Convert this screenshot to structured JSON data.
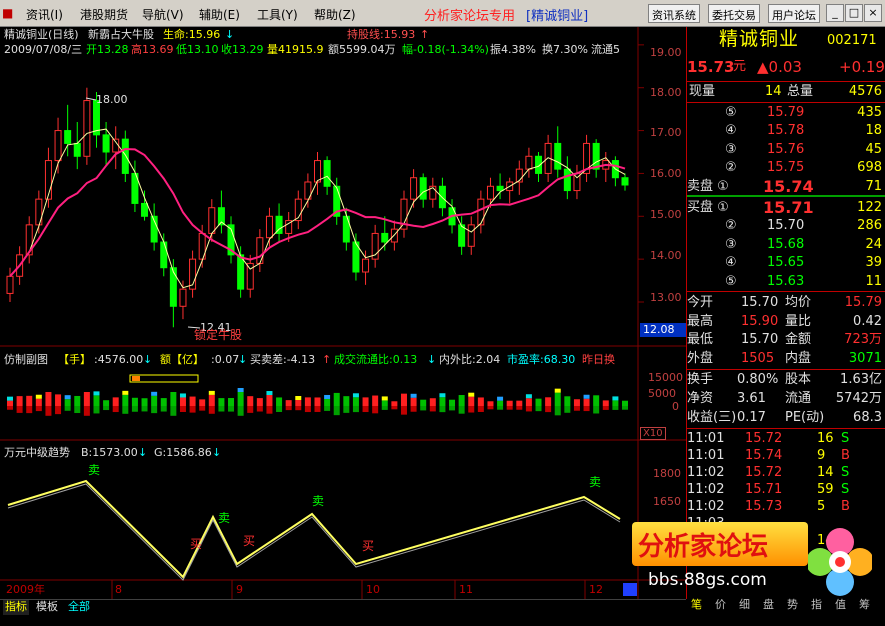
{
  "menu": {
    "items": [
      "资讯(I)",
      "港股期货",
      "导航(V)",
      "辅助(E)",
      "工具(Y)",
      "帮助(Z)"
    ],
    "title_red": "分析家论坛专用",
    "title_bracket": "[精诚铜业]",
    "right_buttons": [
      "资讯系统",
      "委托交易",
      "用户论坛"
    ],
    "window_buttons": [
      "_",
      "□",
      "×"
    ]
  },
  "main": {
    "title": "精诚铜业(日线)",
    "indicator_name": "新霸占大牛股",
    "life_label": "生命:15.96",
    "hold_label": "持股线:15.93",
    "stats_date": "2009/07/08/三",
    "stats_open": "开13.28",
    "stats_high": "高13.69",
    "stats_low": "低13.10",
    "stats_close": "收13.29",
    "stats_vol": "量41915.9",
    "stats_amt": "额5599.04万",
    "stats_chg": "幅-0.18(-1.34%)",
    "stats_amp": "振4.38%",
    "stats_turn": "换7.30%",
    "stats_flow": "流通5",
    "yticks": [
      "19.00",
      "18.00",
      "17.00",
      "16.00",
      "15.00",
      "14.00",
      "13.00"
    ],
    "price_tag": "12.08",
    "hi_mark": "18.00",
    "lo_mark": "12.41",
    "lock_label": "锁定牛股"
  },
  "sub1": {
    "name": "仿制副图",
    "hand": "【手】",
    "vol": ":4576.00",
    "amt_label": "额【亿】",
    "amt": ":0.07",
    "buysell": "买卖差:-4.13",
    "flow_ratio": "成交流通比:0.13",
    "inout": "内外比:2.04",
    "pe": "市盈率:68.30",
    "yesterday": "昨日换",
    "yticks": [
      "15000",
      "5000",
      "0"
    ],
    "scale": "X10"
  },
  "sub2": {
    "name": "万元中级趋势",
    "b": "B:1573.00",
    "g": "G:1586.86",
    "yticks": [
      "1800",
      "1650",
      "1500"
    ],
    "labels": [
      "卖",
      "买",
      "卖",
      "买",
      "卖",
      "买",
      "卖"
    ]
  },
  "xaxis": [
    "2009年",
    "8",
    "9",
    "10",
    "11",
    "12"
  ],
  "bottom_tabs": [
    "指标",
    "模板",
    "全部"
  ],
  "right": {
    "stock_name": "精诚铜业",
    "code": "002171",
    "price": "15.73",
    "unit": "元",
    "change": "▲0.03",
    "change2": "+0.19",
    "now_label": "现量",
    "now_val": "14",
    "total_label": "总量",
    "total_val": "4576",
    "sells": [
      {
        "lvl": "⑤",
        "price": "15.79",
        "vol": "435"
      },
      {
        "lvl": "④",
        "price": "15.78",
        "vol": "18"
      },
      {
        "lvl": "③",
        "price": "15.76",
        "vol": "45"
      },
      {
        "lvl": "②",
        "price": "15.75",
        "vol": "698"
      },
      {
        "lvl": "卖盘 ①",
        "price": "15.74",
        "vol": "71"
      }
    ],
    "buys": [
      {
        "lvl": "买盘 ①",
        "price": "15.71",
        "vol": "122"
      },
      {
        "lvl": "②",
        "price": "15.70",
        "vol": "286"
      },
      {
        "lvl": "③",
        "price": "15.68",
        "vol": "24"
      },
      {
        "lvl": "④",
        "price": "15.65",
        "vol": "39"
      },
      {
        "lvl": "⑤",
        "price": "15.63",
        "vol": "11"
      }
    ],
    "stats": [
      [
        "今开",
        "15.70",
        "均价",
        "15.79"
      ],
      [
        "最高",
        "15.90",
        "量比",
        "0.42"
      ],
      [
        "最低",
        "15.70",
        "金额",
        "723万"
      ],
      [
        "外盘",
        "1505",
        "内盘",
        "3071"
      ]
    ],
    "stats2": [
      [
        "换手",
        "0.80%",
        "股本",
        "1.63亿"
      ],
      [
        "净资",
        "3.61",
        "流通",
        "5742万"
      ],
      [
        "收益(三)",
        "0.17",
        "PE(动)",
        "68.3"
      ]
    ],
    "ticks": [
      [
        "11:01",
        "15.72",
        "16",
        "S"
      ],
      [
        "11:01",
        "15.74",
        "9",
        "B"
      ],
      [
        "11:02",
        "15.72",
        "14",
        "S"
      ],
      [
        "11:02",
        "15.71",
        "59",
        "S"
      ],
      [
        "11:02",
        "15.73",
        "5",
        "B"
      ],
      [
        "11:03",
        "",
        "",
        ""
      ],
      [
        "11:03",
        "",
        "14",
        "S"
      ],
      [
        "11:03",
        "",
        "",
        ""
      ]
    ],
    "bottom_tabs": [
      "笔",
      "价",
      "细",
      "盘",
      "势",
      "指",
      "值",
      "筹"
    ]
  },
  "watermark": {
    "title": "分析家论坛",
    "url": "bbs.88gs.com"
  },
  "colors": {
    "up": "#ff3030",
    "down": "#00ff00",
    "yellow": "#ffff00",
    "cyan": "#00ffff",
    "ma": "#ff2080",
    "grid": "#800000"
  },
  "chart_data": {
    "type": "candlestick",
    "title": "精诚铜业(日线)",
    "ylim": [
      12.3,
      19.3
    ],
    "candles": [
      [
        13.2,
        13.8,
        13.0,
        13.6
      ],
      [
        13.6,
        14.3,
        13.4,
        14.1
      ],
      [
        14.1,
        15.0,
        13.9,
        14.8
      ],
      [
        14.8,
        15.6,
        14.6,
        15.4
      ],
      [
        15.4,
        16.6,
        15.2,
        16.3
      ],
      [
        16.3,
        17.3,
        16.0,
        17.0
      ],
      [
        17.0,
        17.6,
        16.4,
        16.7
      ],
      [
        16.7,
        17.2,
        16.1,
        16.4
      ],
      [
        16.4,
        18.0,
        16.2,
        17.7
      ],
      [
        17.7,
        17.9,
        16.6,
        16.9
      ],
      [
        16.9,
        17.2,
        16.2,
        16.5
      ],
      [
        16.5,
        17.1,
        16.1,
        16.8
      ],
      [
        16.8,
        17.0,
        15.8,
        16.0
      ],
      [
        16.0,
        16.3,
        15.1,
        15.3
      ],
      [
        15.3,
        15.6,
        14.9,
        15.0
      ],
      [
        15.0,
        15.3,
        14.2,
        14.4
      ],
      [
        14.4,
        14.6,
        13.6,
        13.8
      ],
      [
        13.8,
        14.0,
        12.41,
        12.9
      ],
      [
        12.9,
        13.5,
        12.6,
        13.3
      ],
      [
        13.3,
        14.2,
        13.1,
        14.0
      ],
      [
        14.0,
        14.8,
        13.8,
        14.6
      ],
      [
        14.6,
        15.4,
        14.4,
        15.2
      ],
      [
        15.2,
        15.6,
        14.6,
        14.8
      ],
      [
        14.8,
        15.0,
        13.9,
        14.1
      ],
      [
        14.1,
        14.3,
        13.1,
        13.3
      ],
      [
        13.3,
        14.1,
        13.1,
        13.9
      ],
      [
        13.9,
        14.7,
        13.7,
        14.5
      ],
      [
        14.5,
        15.2,
        14.3,
        15.0
      ],
      [
        15.0,
        15.3,
        14.4,
        14.6
      ],
      [
        14.6,
        15.1,
        14.4,
        14.9
      ],
      [
        14.9,
        15.6,
        14.7,
        15.4
      ],
      [
        15.4,
        16.0,
        15.2,
        15.8
      ],
      [
        15.8,
        16.5,
        15.5,
        16.3
      ],
      [
        16.3,
        16.4,
        15.5,
        15.7
      ],
      [
        15.7,
        15.9,
        14.8,
        15.0
      ],
      [
        15.0,
        15.2,
        14.2,
        14.4
      ],
      [
        14.4,
        14.6,
        13.5,
        13.7
      ],
      [
        13.7,
        14.2,
        13.4,
        14.0
      ],
      [
        14.0,
        14.8,
        13.8,
        14.6
      ],
      [
        14.6,
        15.0,
        14.2,
        14.4
      ],
      [
        14.4,
        14.9,
        14.2,
        14.7
      ],
      [
        14.7,
        15.6,
        14.5,
        15.4
      ],
      [
        15.4,
        16.1,
        15.2,
        15.9
      ],
      [
        15.9,
        16.0,
        15.2,
        15.4
      ],
      [
        15.4,
        15.9,
        15.2,
        15.7
      ],
      [
        15.7,
        15.9,
        15.0,
        15.2
      ],
      [
        15.2,
        15.4,
        14.6,
        14.8
      ],
      [
        14.8,
        15.0,
        14.1,
        14.3
      ],
      [
        14.3,
        15.0,
        14.1,
        14.8
      ],
      [
        14.8,
        15.6,
        14.6,
        15.4
      ],
      [
        15.4,
        15.9,
        15.2,
        15.7
      ],
      [
        15.7,
        16.0,
        15.4,
        15.6
      ],
      [
        15.6,
        15.9,
        15.3,
        15.8
      ],
      [
        15.8,
        16.3,
        15.5,
        16.1
      ],
      [
        16.1,
        16.6,
        15.9,
        16.4
      ],
      [
        16.4,
        16.5,
        15.8,
        16.0
      ],
      [
        16.0,
        16.9,
        15.8,
        16.7
      ],
      [
        16.7,
        17.1,
        15.9,
        16.1
      ],
      [
        16.1,
        16.4,
        15.4,
        15.6
      ],
      [
        15.6,
        16.2,
        15.4,
        16.0
      ],
      [
        16.0,
        16.9,
        15.8,
        16.7
      ],
      [
        16.7,
        16.8,
        15.9,
        16.1
      ],
      [
        16.1,
        16.5,
        15.8,
        16.3
      ],
      [
        16.3,
        16.4,
        15.7,
        15.9
      ],
      [
        15.9,
        16.0,
        15.6,
        15.73
      ]
    ]
  }
}
